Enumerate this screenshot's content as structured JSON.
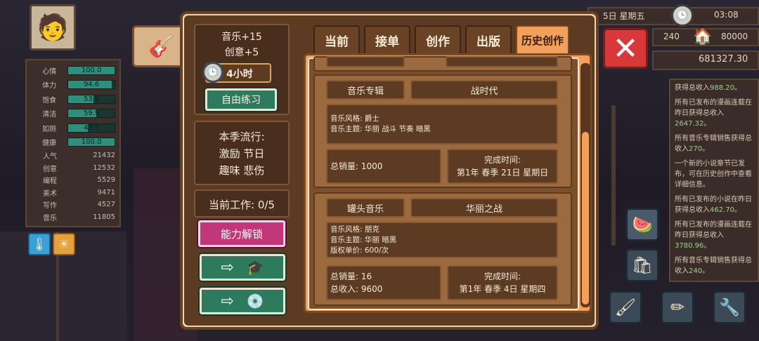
{
  "player_stats": [
    {
      "label": "心情",
      "value": "100.0",
      "fill": 1.0
    },
    {
      "label": "体力",
      "value": "94.6",
      "fill": 0.946
    },
    {
      "label": "饱食",
      "value": "53.9",
      "fill": 0.539
    },
    {
      "label": "清洁",
      "value": "59.9",
      "fill": 0.599
    },
    {
      "label": "如厕",
      "value": "42.7",
      "fill": 0.427
    },
    {
      "label": "健康",
      "value": "100.0",
      "fill": 1.0
    }
  ],
  "player_numbers": [
    {
      "label": "人气",
      "value": "21432"
    },
    {
      "label": "创意",
      "value": "12532"
    },
    {
      "label": "编程",
      "value": "5529"
    },
    {
      "label": "美术",
      "value": "9471"
    },
    {
      "label": "写作",
      "value": "4527"
    },
    {
      "label": "音乐",
      "value": "11805"
    }
  ],
  "hud": {
    "date": "5日  星期五",
    "time": "03:08",
    "left_value": "240",
    "right_value": "80000",
    "money": "681327.30"
  },
  "left_panel": {
    "bonus_music": "音乐+15",
    "bonus_creativity": "创意+5",
    "duration": "4小时",
    "practice_button": "自由练习",
    "trend_title": "本季流行:",
    "trend_line1": "激励 节日",
    "trend_line2": "趣味 悲伤",
    "current_work": "当前工作: 0/5",
    "unlock_button": "能力解锁"
  },
  "tabs": [
    "当前",
    "接单",
    "创作",
    "出版",
    "历史创作"
  ],
  "active_tab": "历史创作",
  "works": [
    {
      "type": "音乐专辑",
      "title": "战时代",
      "desc": [
        "音乐风格:  爵士",
        "音乐主题:  华丽 战斗 节奏 暗黑"
      ],
      "stats": [
        "总销量: 1000"
      ],
      "finish_label": "完成时间:",
      "finish_time": "第1年 春季 21日  星期日"
    },
    {
      "type": "罐头音乐",
      "title": "华丽之战",
      "desc": [
        "音乐风格:  朋克",
        "音乐主题:  华丽 暗黑",
        "版权单价:  600/次"
      ],
      "stats": [
        "总销量: 16",
        "总收入: 9600"
      ],
      "finish_label": "完成时间:",
      "finish_time": "第1年 春季 4日  星期四"
    }
  ],
  "log": [
    {
      "text": "获得总收入",
      "value": "988.20",
      "suffix": "。"
    },
    {
      "text": "所有已发布的漫画连载在昨日获得总收入",
      "value": "2647.32",
      "suffix": "。"
    },
    {
      "text": "所有音乐专辑销售获得总收入",
      "value": "270",
      "suffix": "。"
    },
    {
      "text": "一个新的小说章节已发布，可在历史创作中查看详细信息。",
      "value": "",
      "suffix": ""
    },
    {
      "text": "所有已发布的小说在昨日获得总收入",
      "value": "462.70",
      "suffix": "。"
    },
    {
      "text": "所有已发布的漫画连载在昨日获得总收入",
      "value": "3780.96",
      "suffix": "。"
    },
    {
      "text": "所有音乐专辑销售获得总收入",
      "value": "240",
      "suffix": "。"
    }
  ],
  "icons": {
    "guitar": "guitar-icon",
    "clock": "clock-icon",
    "house": "house-icon",
    "close": "close-icon",
    "graduation_cap": "graduation-cap-icon",
    "record": "record-icon"
  },
  "colors": {
    "accent_orange": "#f2a05b",
    "panel_brown": "#5d3a22",
    "green_button": "#2e7a5f",
    "pink_button": "#c2367a",
    "close_red": "#d7393a",
    "stat_bar": "#2f8f7c"
  }
}
